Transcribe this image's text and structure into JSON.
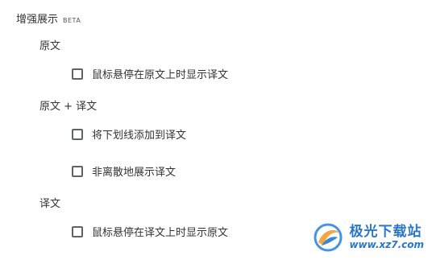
{
  "section": {
    "title": "增强展示",
    "badge": "BETA"
  },
  "groups": [
    {
      "label": "原文",
      "options": [
        {
          "label": "鼠标悬停在原文上时显示译文",
          "checked": false
        }
      ]
    },
    {
      "label": "原文 + 译文",
      "options": [
        {
          "label": "将下划线添加到译文",
          "checked": false
        },
        {
          "label": "非离散地展示译文",
          "checked": false
        }
      ]
    },
    {
      "label": "译文",
      "options": [
        {
          "label": "鼠标悬停在译文上时显示原文",
          "checked": false
        }
      ]
    }
  ],
  "watermark": {
    "name": "极光下载站",
    "url": "www.xz7.com"
  }
}
